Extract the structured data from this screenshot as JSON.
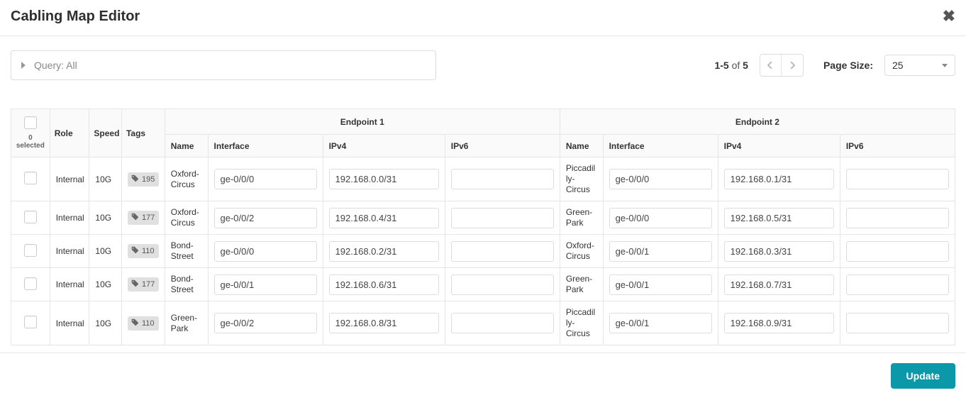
{
  "header": {
    "title": "Cabling Map Editor"
  },
  "toolbar": {
    "query_label": "Query: All",
    "range_bold": "1-5",
    "range_of": " of ",
    "range_total": "5",
    "page_size_label": "Page Size:",
    "page_size_value": "25"
  },
  "columns": {
    "selected_count_label": "0 selected",
    "role": "Role",
    "speed": "Speed",
    "tags": "Tags",
    "endpoint1": "Endpoint 1",
    "endpoint2": "Endpoint 2",
    "name": "Name",
    "interface": "Interface",
    "ipv4": "IPv4",
    "ipv6": "IPv6"
  },
  "rows": [
    {
      "role": "Internal",
      "speed": "10G",
      "tag": "195",
      "ep1": {
        "name": "Oxford-Circus",
        "iface": "ge-0/0/0",
        "ipv4": "192.168.0.0/31",
        "ipv6": ""
      },
      "ep2": {
        "name": "Piccadilly-Circus",
        "iface": "ge-0/0/0",
        "ipv4": "192.168.0.1/31",
        "ipv6": ""
      }
    },
    {
      "role": "Internal",
      "speed": "10G",
      "tag": "177",
      "ep1": {
        "name": "Oxford-Circus",
        "iface": "ge-0/0/2",
        "ipv4": "192.168.0.4/31",
        "ipv6": ""
      },
      "ep2": {
        "name": "Green-Park",
        "iface": "ge-0/0/0",
        "ipv4": "192.168.0.5/31",
        "ipv6": ""
      }
    },
    {
      "role": "Internal",
      "speed": "10G",
      "tag": "110",
      "ep1": {
        "name": "Bond-Street",
        "iface": "ge-0/0/0",
        "ipv4": "192.168.0.2/31",
        "ipv6": ""
      },
      "ep2": {
        "name": "Oxford-Circus",
        "iface": "ge-0/0/1",
        "ipv4": "192.168.0.3/31",
        "ipv6": ""
      }
    },
    {
      "role": "Internal",
      "speed": "10G",
      "tag": "177",
      "ep1": {
        "name": "Bond-Street",
        "iface": "ge-0/0/1",
        "ipv4": "192.168.0.6/31",
        "ipv6": ""
      },
      "ep2": {
        "name": "Green-Park",
        "iface": "ge-0/0/1",
        "ipv4": "192.168.0.7/31",
        "ipv6": ""
      }
    },
    {
      "role": "Internal",
      "speed": "10G",
      "tag": "110",
      "ep1": {
        "name": "Green-Park",
        "iface": "ge-0/0/2",
        "ipv4": "192.168.0.8/31",
        "ipv6": ""
      },
      "ep2": {
        "name": "Piccadilly-Circus",
        "iface": "ge-0/0/1",
        "ipv4": "192.168.0.9/31",
        "ipv6": ""
      }
    }
  ],
  "footer": {
    "update_label": "Update"
  }
}
